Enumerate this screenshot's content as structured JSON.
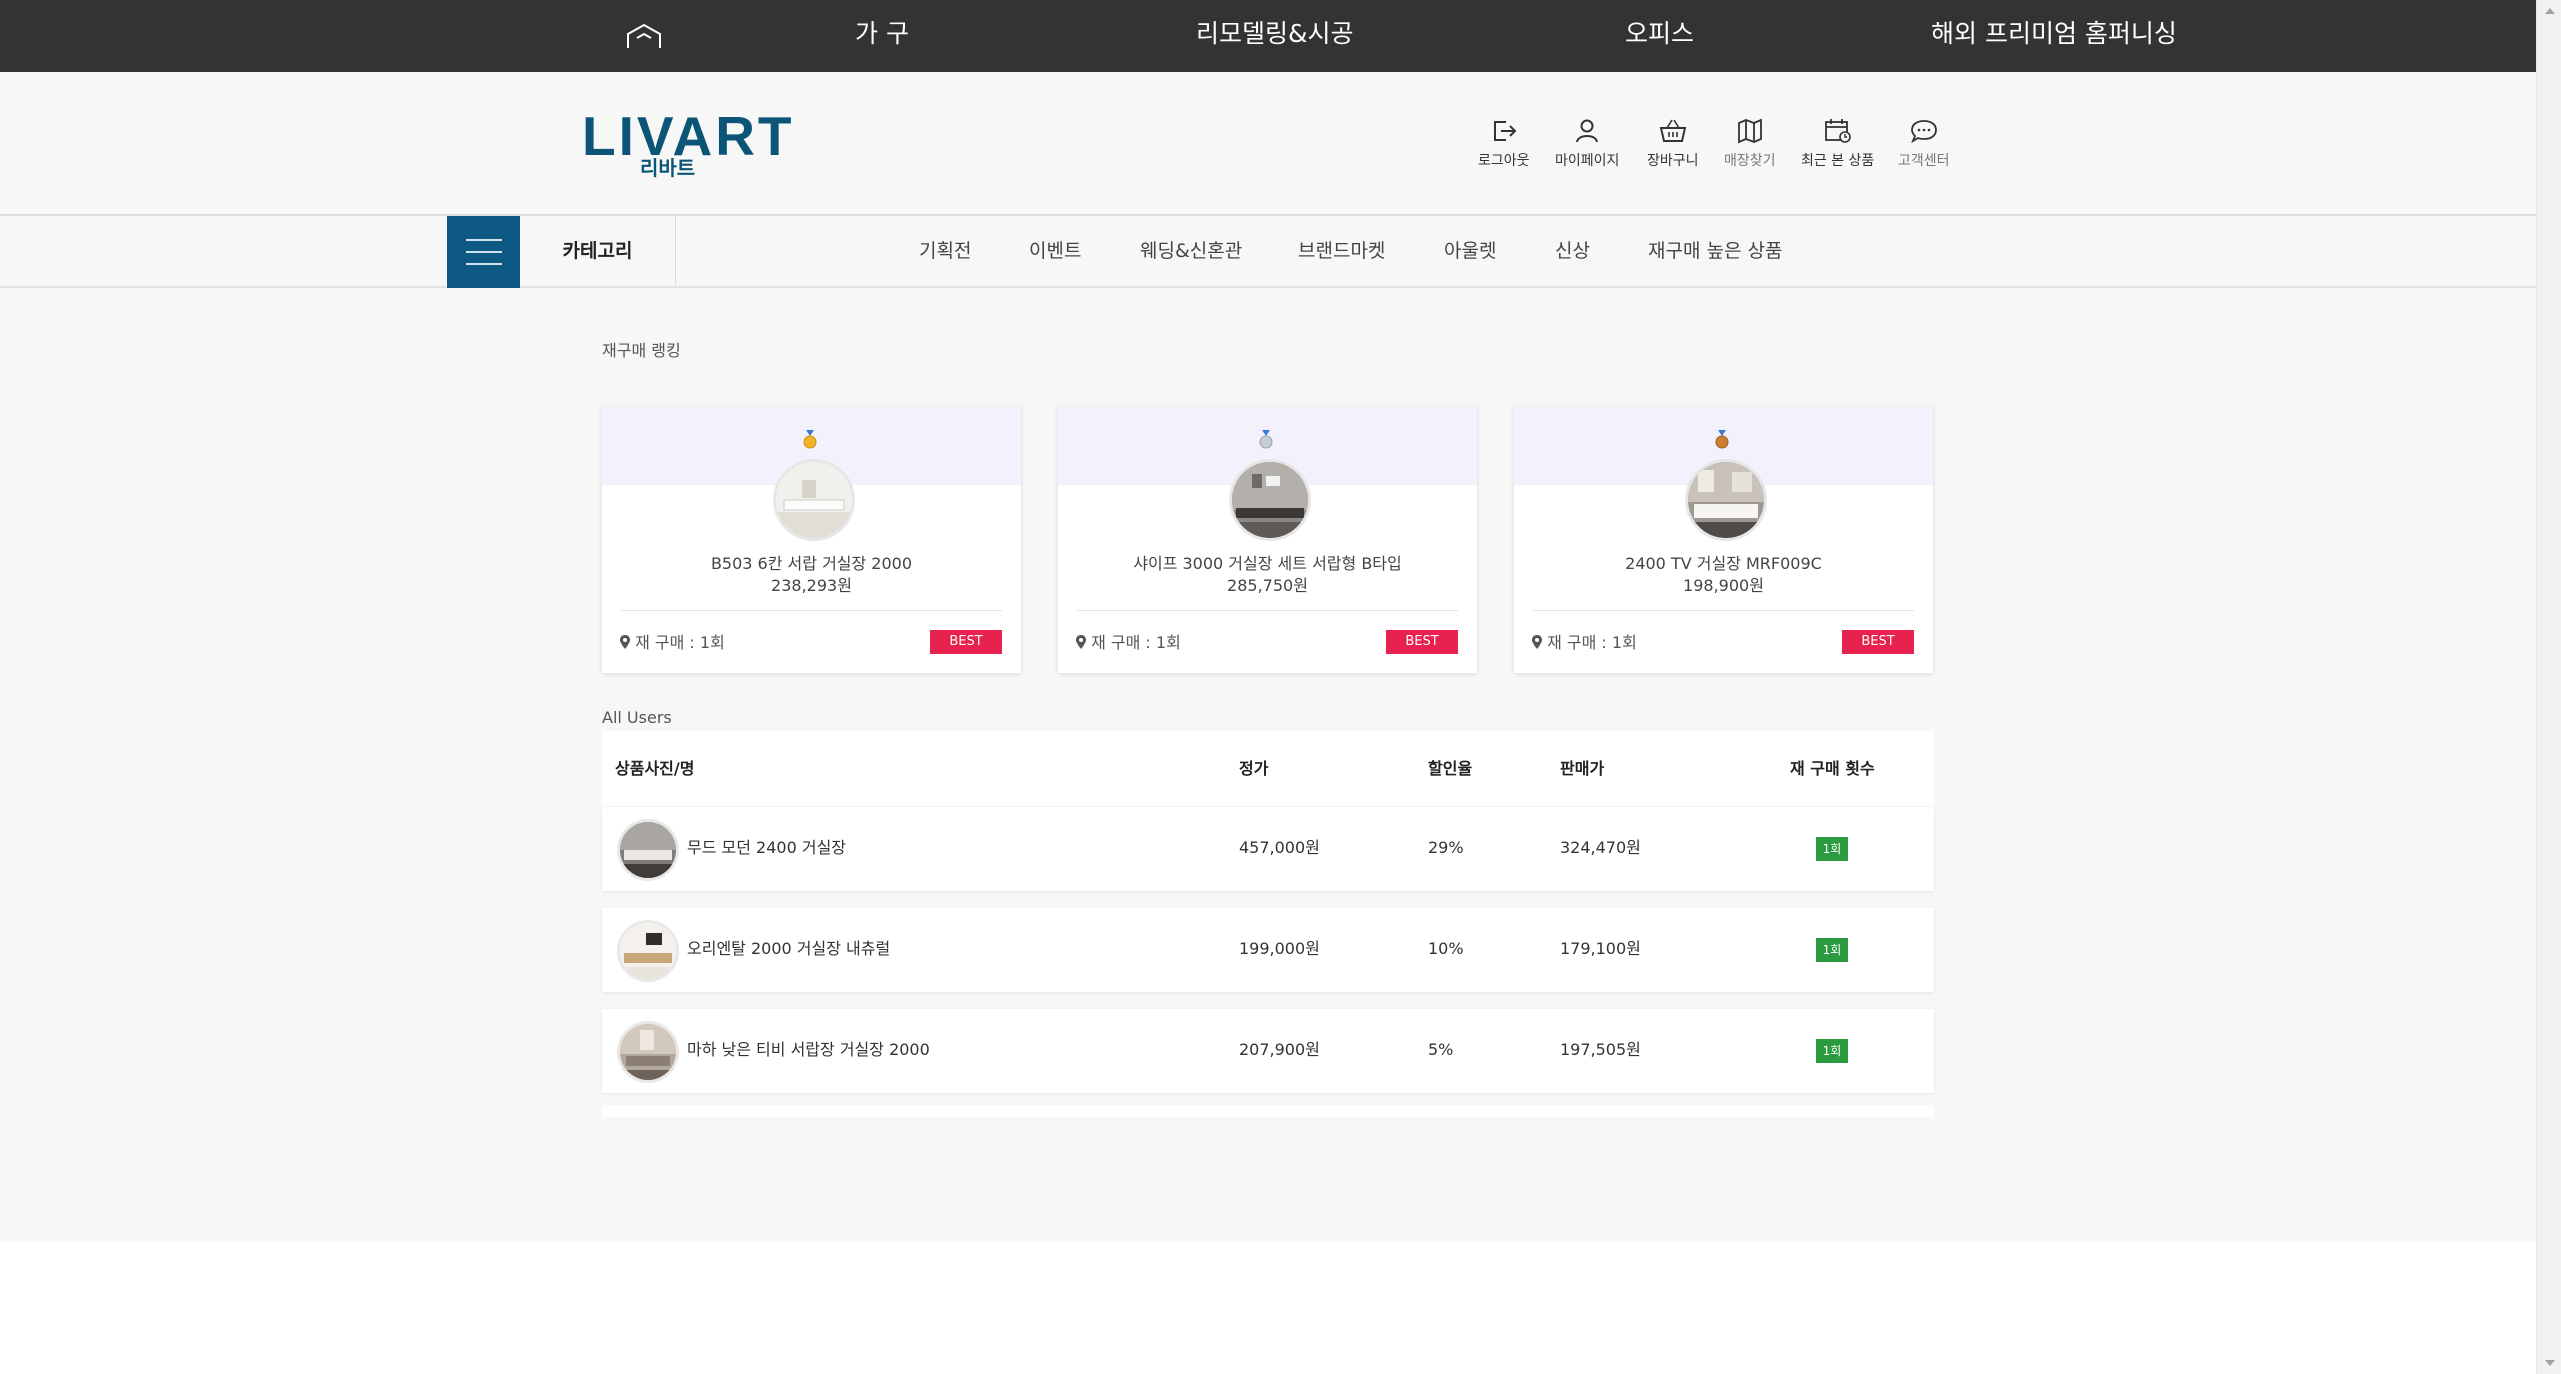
{
  "top_nav": {
    "items": [
      {
        "label": "가 구"
      },
      {
        "label": "리모델링&시공"
      },
      {
        "label": "오피스"
      },
      {
        "label": "해외 프리미엄 홈퍼니싱"
      }
    ]
  },
  "brand": {
    "logo_text": "LIVART",
    "logo_sub": "리바트",
    "brand_color": "#0b5677"
  },
  "utility_menu": [
    {
      "label": "로그아웃",
      "icon": "logout-icon"
    },
    {
      "label": "마이페이지",
      "icon": "user-icon"
    },
    {
      "label": "장바구니",
      "icon": "basket-icon"
    },
    {
      "label": "매장찾기",
      "icon": "map-icon"
    },
    {
      "label": "최근 본 상품",
      "icon": "recent-icon"
    },
    {
      "label": "고객센터",
      "icon": "chat-icon"
    }
  ],
  "category_nav": {
    "category_label": "카테고리",
    "items": [
      {
        "label": "기획전"
      },
      {
        "label": "이벤트"
      },
      {
        "label": "웨딩&신혼관"
      },
      {
        "label": "브랜드마켓"
      },
      {
        "label": "아울렛"
      },
      {
        "label": "신상"
      },
      {
        "label": "재구매 높은 상품"
      }
    ]
  },
  "ranking": {
    "title": "재구매 랭킹",
    "cards": [
      {
        "medal": "gold-medal-icon",
        "name": "B503 6칸 서랍 거실장 2000",
        "price": "238,293원",
        "repurchase": "재 구매 : 1회",
        "badge": "BEST"
      },
      {
        "medal": "silver-medal-icon",
        "name": "샤이프 3000 거실장 세트 서랍형 B타입",
        "price": "285,750원",
        "repurchase": "재 구매 : 1회",
        "badge": "BEST"
      },
      {
        "medal": "bronze-medal-icon",
        "name": "2400 TV 거실장 MRF009C",
        "price": "198,900원",
        "repurchase": "재 구매 : 1회",
        "badge": "BEST"
      }
    ]
  },
  "table": {
    "title": "All Users",
    "headers": {
      "product": "상품사진/명",
      "list_price": "정가",
      "discount": "할인율",
      "sale_price": "판매가",
      "repurchase": "재 구매 횟수"
    },
    "rows": [
      {
        "name": "무드 모던 2400 거실장",
        "list_price": "457,000원",
        "discount": "29%",
        "sale_price": "324,470원",
        "repurchase": "1회"
      },
      {
        "name": "오리엔탈 2000 거실장 내츄럴",
        "list_price": "199,000원",
        "discount": "10%",
        "sale_price": "179,100원",
        "repurchase": "1회"
      },
      {
        "name": "마하 낮은 티비 서랍장 거실장 2000",
        "list_price": "207,900원",
        "discount": "5%",
        "sale_price": "197,505원",
        "repurchase": "1회"
      }
    ]
  },
  "colors": {
    "top_bar": "#333333",
    "best_badge": "#e8224f",
    "count_badge": "#2a9b3f",
    "menu_button": "#0e5a84"
  }
}
